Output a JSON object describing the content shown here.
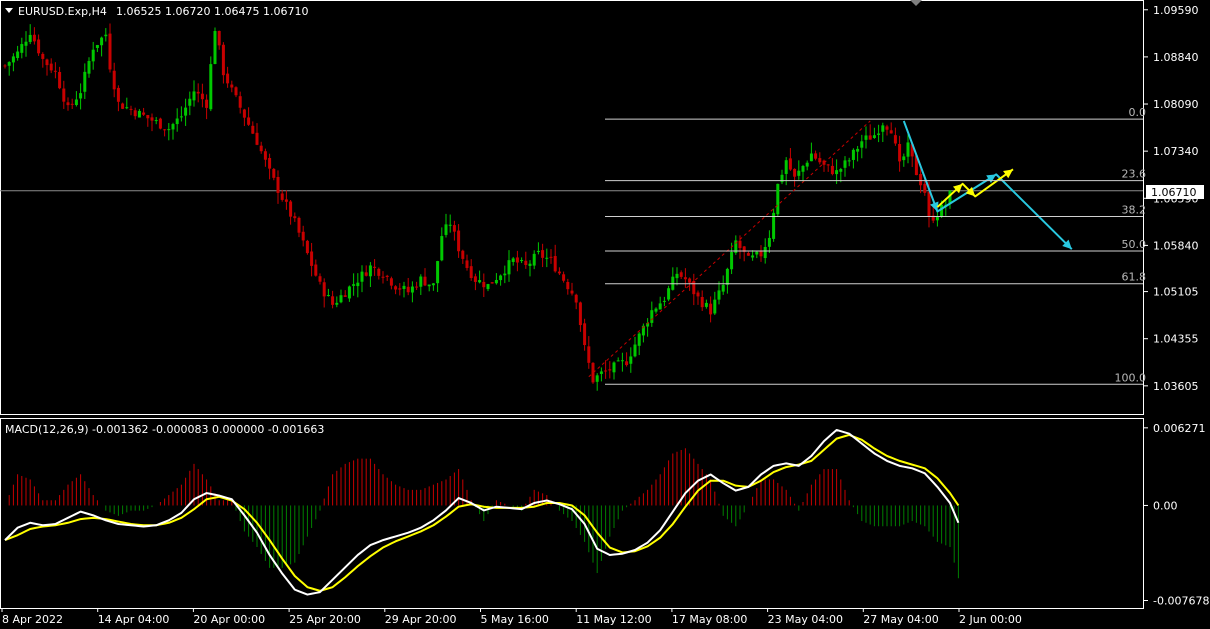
{
  "window": {
    "symbol_line": "EURUSD.Exp,H4",
    "ohlc": "1.06525 1.06720 1.06475 1.06710",
    "collapse_icon": "triangle-down-icon"
  },
  "colors": {
    "background": "#000000",
    "bull": "#00c800",
    "bear": "#c80000",
    "macd_main": "#ffffff",
    "macd_signal": "#ffff00",
    "hist_pos": "#c80000",
    "hist_neg": "#008000",
    "fib": "#cfcfcf",
    "arrow_yellow": "#ffff00",
    "arrow_cyan": "#29c8e0",
    "trend_line": "#c80000"
  },
  "chart_data": [
    {
      "type": "candlestick",
      "title": "",
      "price_scale": [
        "1.09590",
        "1.08840",
        "1.08090",
        "1.07340",
        "1.06590",
        "1.05840",
        "1.05105",
        "1.04355",
        "1.03605"
      ],
      "ylim": [
        1.033,
        1.0965
      ],
      "current_price": "1.06710",
      "time_labels": [
        "8 Apr 2022",
        "14 Apr 04:00",
        "20 Apr 00:00",
        "25 Apr 20:00",
        "29 Apr 20:00",
        "5 May 16:00",
        "11 May 12:00",
        "17 May 08:00",
        "23 May 04:00",
        "27 May 04:00",
        "2 Jun 00:00"
      ],
      "close_path": [
        [
          0,
          1.087
        ],
        [
          3,
          1.089
        ],
        [
          6,
          1.0925
        ],
        [
          9,
          1.088
        ],
        [
          12,
          1.086
        ],
        [
          15,
          1.08
        ],
        [
          18,
          1.083
        ],
        [
          21,
          1.09
        ],
        [
          24,
          1.092
        ],
        [
          25,
          1.087
        ],
        [
          27,
          1.081
        ],
        [
          30,
          1.08
        ],
        [
          33,
          1.079
        ],
        [
          36,
          1.078
        ],
        [
          39,
          1.077
        ],
        [
          42,
          1.079
        ],
        [
          45,
          1.083
        ],
        [
          48,
          1.081
        ],
        [
          50,
          1.093
        ],
        [
          52,
          1.086
        ],
        [
          54,
          1.083
        ],
        [
          57,
          1.079
        ],
        [
          60,
          1.075
        ],
        [
          63,
          1.07
        ],
        [
          66,
          1.066
        ],
        [
          69,
          1.062
        ],
        [
          72,
          1.057
        ],
        [
          75,
          1.052
        ],
        [
          78,
          1.049
        ],
        [
          81,
          1.051
        ],
        [
          84,
          1.053
        ],
        [
          87,
          1.055
        ],
        [
          90,
          1.054
        ],
        [
          93,
          1.052
        ],
        [
          96,
          1.051
        ],
        [
          99,
          1.053
        ],
        [
          102,
          1.052
        ],
        [
          104,
          1.06
        ],
        [
          106,
          1.062
        ],
        [
          108,
          1.058
        ],
        [
          110,
          1.055
        ],
        [
          112,
          1.053
        ],
        [
          115,
          1.052
        ],
        [
          118,
          1.054
        ],
        [
          121,
          1.056
        ],
        [
          124,
          1.055
        ],
        [
          127,
          1.057
        ],
        [
          130,
          1.056
        ],
        [
          133,
          1.053
        ],
        [
          136,
          1.05
        ],
        [
          138,
          1.042
        ],
        [
          140,
          1.037
        ],
        [
          142,
          1.038
        ],
        [
          145,
          1.039
        ],
        [
          148,
          1.04
        ],
        [
          151,
          1.044
        ],
        [
          154,
          1.048
        ],
        [
          157,
          1.05
        ],
        [
          160,
          1.054
        ],
        [
          162,
          1.053
        ],
        [
          165,
          1.05
        ],
        [
          168,
          1.048
        ],
        [
          171,
          1.052
        ],
        [
          174,
          1.059
        ],
        [
          177,
          1.056
        ],
        [
          180,
          1.057
        ],
        [
          182,
          1.06
        ],
        [
          184,
          1.068
        ],
        [
          186,
          1.072
        ],
        [
          188,
          1.069
        ],
        [
          190,
          1.071
        ],
        [
          192,
          1.073
        ],
        [
          195,
          1.071
        ],
        [
          198,
          1.07
        ],
        [
          201,
          1.072
        ],
        [
          204,
          1.075
        ],
        [
          207,
          1.076
        ],
        [
          209,
          1.078
        ],
        [
          211,
          1.077
        ],
        [
          213,
          1.071
        ],
        [
          215,
          1.074
        ],
        [
          217,
          1.07
        ],
        [
          219,
          1.067
        ],
        [
          220,
          1.0625
        ],
        [
          222,
          1.0635
        ],
        [
          224,
          1.065
        ],
        [
          225,
          1.0671
        ]
      ]
    },
    {
      "type": "line",
      "title": "MACD(12,26,9) -0.001362 -0.000083 0.000000 -0.001663",
      "scale_labels": [
        "0.006271",
        "0.00",
        "-0.007678"
      ],
      "ylim": [
        -0.0078,
        0.0065
      ],
      "series": [
        {
          "key": "main",
          "values": [
            [
              0,
              -0.0028
            ],
            [
              3,
              -0.0018
            ],
            [
              6,
              -0.0014
            ],
            [
              9,
              -0.0016
            ],
            [
              12,
              -0.0015
            ],
            [
              15,
              -0.001
            ],
            [
              18,
              -0.0005
            ],
            [
              21,
              -0.0008
            ],
            [
              24,
              -0.0012
            ],
            [
              27,
              -0.0015
            ],
            [
              30,
              -0.0016
            ],
            [
              33,
              -0.0017
            ],
            [
              36,
              -0.0016
            ],
            [
              39,
              -0.0012
            ],
            [
              42,
              -0.0006
            ],
            [
              45,
              0.0005
            ],
            [
              48,
              0.001
            ],
            [
              51,
              0.0008
            ],
            [
              54,
              0.0005
            ],
            [
              57,
              -0.0008
            ],
            [
              60,
              -0.0022
            ],
            [
              63,
              -0.004
            ],
            [
              66,
              -0.0055
            ],
            [
              69,
              -0.0068
            ],
            [
              72,
              -0.0072
            ],
            [
              75,
              -0.007
            ],
            [
              78,
              -0.006
            ],
            [
              81,
              -0.005
            ],
            [
              84,
              -0.004
            ],
            [
              87,
              -0.0032
            ],
            [
              90,
              -0.0028
            ],
            [
              93,
              -0.0025
            ],
            [
              96,
              -0.0022
            ],
            [
              99,
              -0.0018
            ],
            [
              102,
              -0.0012
            ],
            [
              105,
              -0.0004
            ],
            [
              108,
              0.0006
            ],
            [
              111,
              0.0002
            ],
            [
              114,
              -0.0004
            ],
            [
              117,
              -0.0001
            ],
            [
              120,
              -0.0002
            ],
            [
              123,
              -0.0003
            ],
            [
              126,
              0.0002
            ],
            [
              129,
              0.0004
            ],
            [
              132,
              0.0001
            ],
            [
              135,
              -0.0003
            ],
            [
              138,
              -0.0015
            ],
            [
              141,
              -0.0035
            ],
            [
              144,
              -0.004
            ],
            [
              147,
              -0.0039
            ],
            [
              150,
              -0.0036
            ],
            [
              153,
              -0.003
            ],
            [
              156,
              -0.002
            ],
            [
              159,
              -0.0005
            ],
            [
              162,
              0.001
            ],
            [
              165,
              0.002
            ],
            [
              168,
              0.0025
            ],
            [
              171,
              0.0018
            ],
            [
              174,
              0.0012
            ],
            [
              177,
              0.0015
            ],
            [
              180,
              0.0025
            ],
            [
              183,
              0.0032
            ],
            [
              186,
              0.0034
            ],
            [
              189,
              0.0032
            ],
            [
              192,
              0.004
            ],
            [
              195,
              0.0052
            ],
            [
              198,
              0.0061
            ],
            [
              201,
              0.0058
            ],
            [
              204,
              0.005
            ],
            [
              207,
              0.0042
            ],
            [
              210,
              0.0036
            ],
            [
              213,
              0.0032
            ],
            [
              216,
              0.003
            ],
            [
              219,
              0.0026
            ],
            [
              222,
              0.0015
            ],
            [
              225,
              0.0002
            ],
            [
              227,
              -0.0014
            ]
          ]
        },
        {
          "key": "signal",
          "values": [
            [
              0,
              -0.0028
            ],
            [
              3,
              -0.0024
            ],
            [
              6,
              -0.0019
            ],
            [
              9,
              -0.0017
            ],
            [
              12,
              -0.0016
            ],
            [
              15,
              -0.0014
            ],
            [
              18,
              -0.0011
            ],
            [
              21,
              -0.001
            ],
            [
              24,
              -0.0011
            ],
            [
              27,
              -0.0013
            ],
            [
              30,
              -0.0015
            ],
            [
              33,
              -0.0016
            ],
            [
              36,
              -0.0016
            ],
            [
              39,
              -0.0014
            ],
            [
              42,
              -0.001
            ],
            [
              45,
              -0.0003
            ],
            [
              48,
              0.0005
            ],
            [
              51,
              0.0007
            ],
            [
              54,
              0.0004
            ],
            [
              57,
              -0.0003
            ],
            [
              60,
              -0.0014
            ],
            [
              63,
              -0.0028
            ],
            [
              66,
              -0.0043
            ],
            [
              69,
              -0.0057
            ],
            [
              72,
              -0.0066
            ],
            [
              75,
              -0.0069
            ],
            [
              78,
              -0.0066
            ],
            [
              81,
              -0.0058
            ],
            [
              84,
              -0.0049
            ],
            [
              87,
              -0.0041
            ],
            [
              90,
              -0.0034
            ],
            [
              93,
              -0.0029
            ],
            [
              96,
              -0.0025
            ],
            [
              99,
              -0.0021
            ],
            [
              102,
              -0.0016
            ],
            [
              105,
              -0.0009
            ],
            [
              108,
              -0.0001
            ],
            [
              111,
              0.0001
            ],
            [
              114,
              -0.0001
            ],
            [
              117,
              -0.0002
            ],
            [
              120,
              -0.0002
            ],
            [
              123,
              -0.0002
            ],
            [
              126,
              -0.0001
            ],
            [
              129,
              0.0002
            ],
            [
              132,
              0.0002
            ],
            [
              135,
              0.0
            ],
            [
              138,
              -0.0008
            ],
            [
              141,
              -0.0022
            ],
            [
              144,
              -0.0034
            ],
            [
              147,
              -0.0038
            ],
            [
              150,
              -0.0037
            ],
            [
              153,
              -0.0033
            ],
            [
              156,
              -0.0026
            ],
            [
              159,
              -0.0015
            ],
            [
              162,
              -0.0001
            ],
            [
              165,
              0.0012
            ],
            [
              168,
              0.002
            ],
            [
              171,
              0.002
            ],
            [
              174,
              0.0016
            ],
            [
              177,
              0.0015
            ],
            [
              180,
              0.002
            ],
            [
              183,
              0.0027
            ],
            [
              186,
              0.0031
            ],
            [
              189,
              0.0033
            ],
            [
              192,
              0.0036
            ],
            [
              195,
              0.0045
            ],
            [
              198,
              0.0054
            ],
            [
              201,
              0.0057
            ],
            [
              204,
              0.0053
            ],
            [
              207,
              0.0046
            ],
            [
              210,
              0.004
            ],
            [
              213,
              0.0036
            ],
            [
              216,
              0.0033
            ],
            [
              219,
              0.003
            ],
            [
              222,
              0.0022
            ],
            [
              225,
              0.001
            ],
            [
              227,
              0.0
            ]
          ]
        }
      ],
      "histogram_sign_runs": [
        [
          0,
          12,
          1
        ],
        [
          13,
          22,
          -1
        ],
        [
          23,
          33,
          -1
        ],
        [
          34,
          44,
          1
        ],
        [
          45,
          55,
          1
        ],
        [
          56,
          70,
          -1
        ],
        [
          71,
          83,
          -1
        ],
        [
          84,
          100,
          1
        ],
        [
          101,
          110,
          1
        ],
        [
          111,
          124,
          -1
        ],
        [
          125,
          136,
          1
        ],
        [
          137,
          152,
          -1
        ],
        [
          153,
          170,
          1
        ],
        [
          171,
          182,
          -1
        ],
        [
          183,
          200,
          1
        ],
        [
          201,
          215,
          -1
        ],
        [
          216,
          227,
          -1
        ]
      ]
    }
  ],
  "fibonacci": {
    "levels": [
      {
        "label": "0.0",
        "price": 1.0785
      },
      {
        "label": "23.6",
        "price": 1.0687
      },
      {
        "label": "38.2",
        "price": 1.063
      },
      {
        "label": "50.0",
        "price": 1.0575
      },
      {
        "label": "61.8",
        "price": 1.0523
      },
      {
        "label": "100.0",
        "price": 1.0363
      }
    ]
  },
  "projection": {
    "cyan_points": [
      [
        214,
        1.0782
      ],
      [
        222,
        1.0638
      ],
      [
        236,
        1.0697
      ],
      [
        254,
        1.0578
      ]
    ],
    "yellow_points": [
      [
        222,
        1.0645
      ],
      [
        228,
        1.0682
      ],
      [
        231,
        1.0662
      ],
      [
        240,
        1.0705
      ]
    ]
  },
  "trend_line_points": [
    [
      139,
      1.0375
    ],
    [
      206,
      1.0782
    ]
  ]
}
